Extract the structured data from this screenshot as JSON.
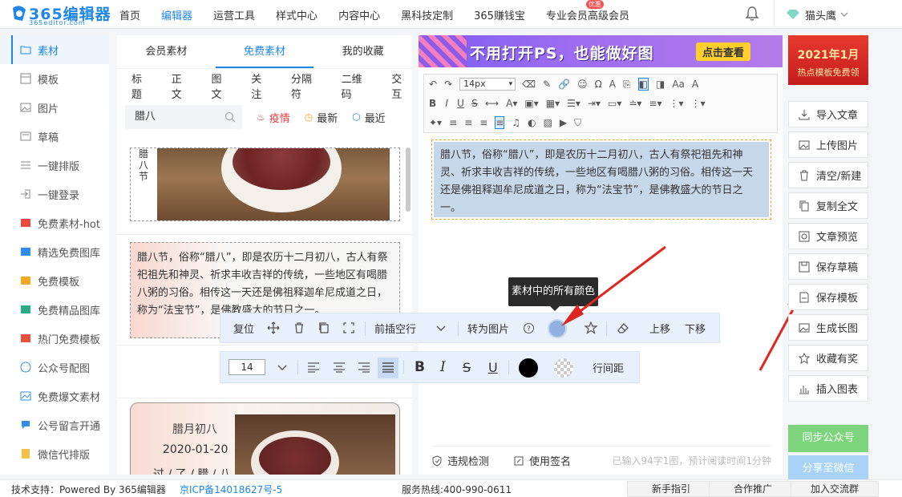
{
  "logo": {
    "name": "365编辑器",
    "sub": "365editor.com"
  },
  "nav": {
    "items": [
      "首页",
      "编辑器",
      "运营工具",
      "样式中心",
      "内容中心",
      "黑科技定制",
      "365赚钱宝",
      "专业会员",
      "高级会员"
    ],
    "badge": "优惠",
    "user": "猫头鹰"
  },
  "leftnav": {
    "items": [
      "素材",
      "模板",
      "图片",
      "草稿",
      "一键排版",
      "一键登录",
      "免费素材-hot",
      "精选免费图库",
      "免费模板",
      "免费精品图库",
      "热门免费模板",
      "公众号配图",
      "免费爆文素材",
      "公号留言开通",
      "微信代排版"
    ]
  },
  "material": {
    "tabs": [
      "会员素材",
      "免费素材",
      "我的收藏"
    ],
    "categories": [
      "标题",
      "正文",
      "图文",
      "关注",
      "分隔符",
      "二维码",
      "交互"
    ],
    "search_value": "腊八",
    "filters": [
      "疫情",
      "最新",
      "最近"
    ],
    "card1_vtext": "腊八节",
    "card2_text": "腊八节，俗称“腊八”，即是农历十二月初八，古人有祭祀祖先和神灵、祈求丰收吉祥的传统，一些地区有喝腊八粥的习俗。相传这一天还是佛祖释迦牟尼成道之日，称为“法宝节”，是佛教盛大的节日之一。",
    "card3": {
      "title": "腊月初八",
      "date": "2020-01-20",
      "text": "过 / 了 / 腊 / 八"
    }
  },
  "banner": {
    "text": "不用打开PS，也能做好图",
    "button": "点击查看"
  },
  "editor": {
    "font_size": "14px",
    "content": "腊八节，俗称“腊八”，即是农历十二月初八，古人有祭祀祖先和神灵、祈求丰收吉祥的传统，一些地区有喝腊八粥的习俗。相传这一天还是佛祖释迦牟尼成道之日，称为“法宝节”，是佛教盛大的节日之一。",
    "footer": {
      "check": "违规检测",
      "sign": "使用签名",
      "status": "已输入94字1图，预计阅读时间1分钟"
    }
  },
  "float1": {
    "reset": "复位",
    "insert": "前插空行",
    "to_image": "转为图片",
    "up": "上移",
    "down": "下移",
    "tooltip": "素材中的所有颜色"
  },
  "float2": {
    "size": "14",
    "line_height": "行间距"
  },
  "rightcol": {
    "promo_line1": "2021年1月",
    "promo_line2": "热点模板免费领",
    "buttons": [
      "导入文章",
      "上传图片",
      "清空/新建",
      "复制全文",
      "文章预览",
      "保存草稿",
      "保存模板",
      "生成长图",
      "收藏有奖",
      "插入图表"
    ],
    "sync": "同步公众号",
    "share": "分享至微信"
  },
  "footer": {
    "support": "技术支持：Powered By 365编辑器",
    "icp": "京ICP备14018627号-5",
    "hotline": "服务热线:400-990-0611",
    "buttons": [
      "新手指引",
      "合作推广",
      "加入交流群"
    ]
  },
  "colors": {
    "accent": "#1e86e6",
    "selected_color": "#8fb0e0",
    "arrow": "#e0271f"
  }
}
